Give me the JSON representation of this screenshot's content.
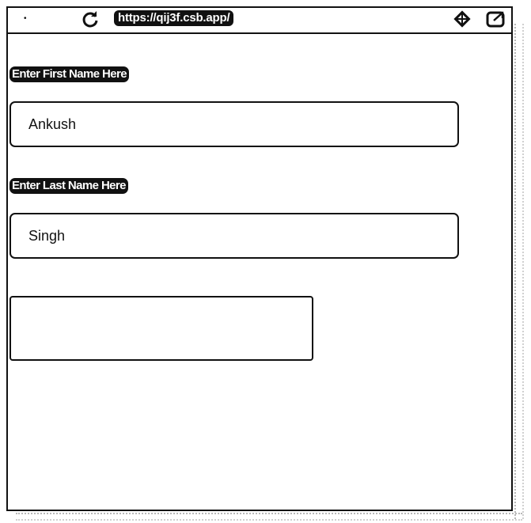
{
  "browser": {
    "url": "https://qij3f.csb.app/",
    "back_glyph": "•"
  },
  "form": {
    "first_name": {
      "label": "Enter First Name Here",
      "value": "Ankush"
    },
    "last_name": {
      "label": "Enter Last Name Here",
      "value": "Singh"
    },
    "submit_label": ""
  }
}
